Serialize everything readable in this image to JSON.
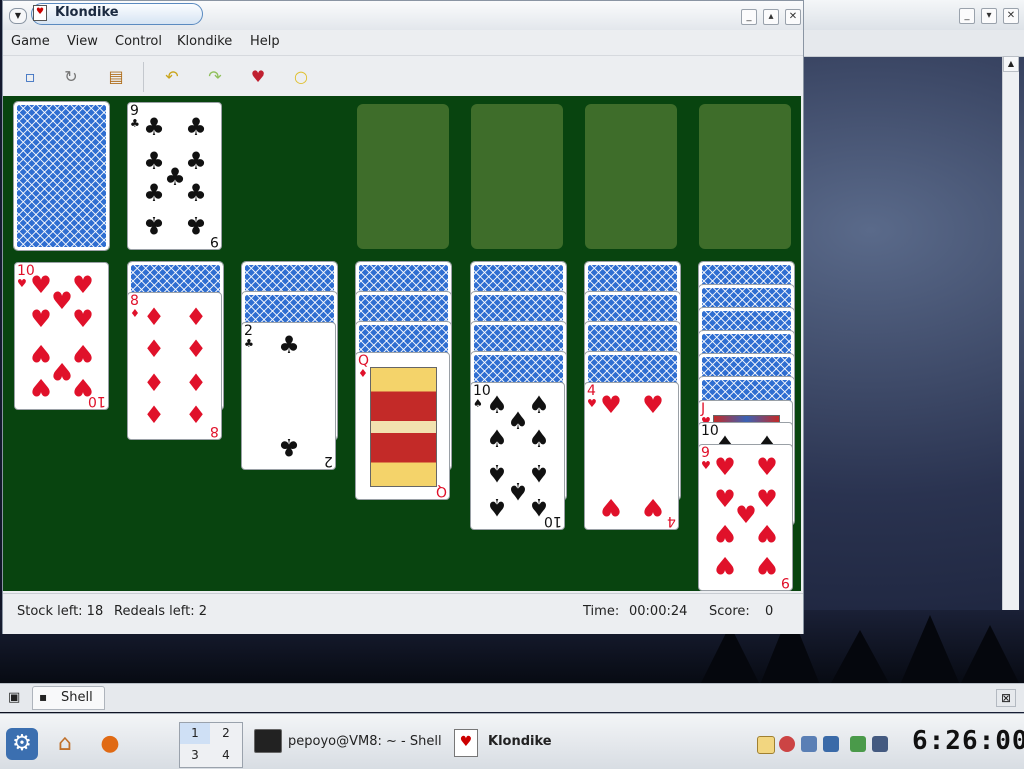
{
  "window": {
    "title": "Klondike"
  },
  "menubar": [
    "Game",
    "View",
    "Control",
    "Klondike",
    "Help"
  ],
  "toolbar": {
    "items": [
      "new-game-icon",
      "restart-icon",
      "deal-icon",
      "undo-icon",
      "redo-icon",
      "hint-card-icon",
      "hint-bulb-icon"
    ]
  },
  "board": {
    "waste": {
      "rank": "9",
      "suit": "♣"
    },
    "tableau": [
      {
        "hidden": 0,
        "cards": [
          {
            "rank": "10",
            "suit": "♥"
          }
        ]
      },
      {
        "hidden": 1,
        "cards": [
          {
            "rank": "8",
            "suit": "♦"
          }
        ]
      },
      {
        "hidden": 2,
        "cards": [
          {
            "rank": "2",
            "suit": "♣"
          }
        ]
      },
      {
        "hidden": 3,
        "cards": [
          {
            "rank": "Q",
            "suit": "♦"
          }
        ]
      },
      {
        "hidden": 4,
        "cards": [
          {
            "rank": "10",
            "suit": "♠"
          }
        ]
      },
      {
        "hidden": 4,
        "cards": [
          {
            "rank": "4",
            "suit": "♥"
          }
        ]
      },
      {
        "hidden": 6,
        "cards": [
          {
            "rank": "J",
            "suit": "♥"
          },
          {
            "rank": "10",
            "suit": "♠"
          },
          {
            "rank": "9",
            "suit": "♥"
          }
        ]
      }
    ]
  },
  "status": {
    "stock_left": "Stock left: 18",
    "redeals_left": "Redeals left: 2",
    "time_label": "Time:",
    "time_value": "00:00:24",
    "score_label": "Score:",
    "score_value": "0"
  },
  "konsole_tab": {
    "label": "Shell"
  },
  "taskbar": {
    "pager": [
      "1",
      "2",
      "3",
      "4"
    ],
    "tasks": [
      {
        "label": "pepoyo@VM8: ~ - Shell"
      },
      {
        "label": "Klondike"
      }
    ],
    "clock": "6:26:00"
  },
  "colors": {
    "felt": "#08440f",
    "slot": "#3e6d2a",
    "card_back": "#2f6ed1",
    "red_suit": "#e0112a"
  }
}
